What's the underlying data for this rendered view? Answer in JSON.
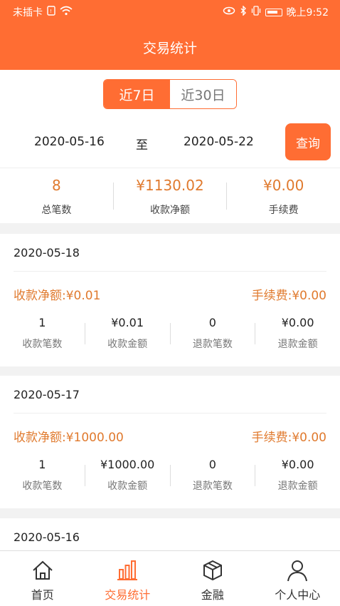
{
  "status_bar": {
    "carrier": "未插卡",
    "time": "晚上9:52"
  },
  "header": {
    "title": "交易统计"
  },
  "period_tabs": [
    {
      "label": "近7日",
      "active": true
    },
    {
      "label": "近30日",
      "active": false
    }
  ],
  "date_range": {
    "start": "2020-05-16",
    "separator": "至",
    "end": "2020-05-22",
    "query_label": "查询"
  },
  "summary": [
    {
      "value": "8",
      "label": "总笔数"
    },
    {
      "value": "¥1130.02",
      "label": "收款净额"
    },
    {
      "value": "¥0.00",
      "label": "手续费"
    }
  ],
  "days": [
    {
      "date": "2020-05-18",
      "net": "收款净额:¥0.01",
      "fee": "手续费:¥0.00",
      "stats": [
        {
          "value": "1",
          "label": "收款笔数"
        },
        {
          "value": "¥0.01",
          "label": "收款金额"
        },
        {
          "value": "0",
          "label": "退款笔数"
        },
        {
          "value": "¥0.00",
          "label": "退款金额"
        }
      ]
    },
    {
      "date": "2020-05-17",
      "net": "收款净额:¥1000.00",
      "fee": "手续费:¥0.00",
      "stats": [
        {
          "value": "1",
          "label": "收款笔数"
        },
        {
          "value": "¥1000.00",
          "label": "收款金额"
        },
        {
          "value": "0",
          "label": "退款笔数"
        },
        {
          "value": "¥0.00",
          "label": "退款金额"
        }
      ]
    },
    {
      "date": "2020-05-16"
    }
  ],
  "tabbar": [
    {
      "label": "首页",
      "icon": "home-icon",
      "active": false
    },
    {
      "label": "交易统计",
      "icon": "bar-chart-icon",
      "active": true
    },
    {
      "label": "金融",
      "icon": "cube-icon",
      "active": false
    },
    {
      "label": "个人中心",
      "icon": "user-icon",
      "active": false
    }
  ],
  "colors": {
    "accent": "#ff6d33",
    "amount": "#e07a2e"
  }
}
